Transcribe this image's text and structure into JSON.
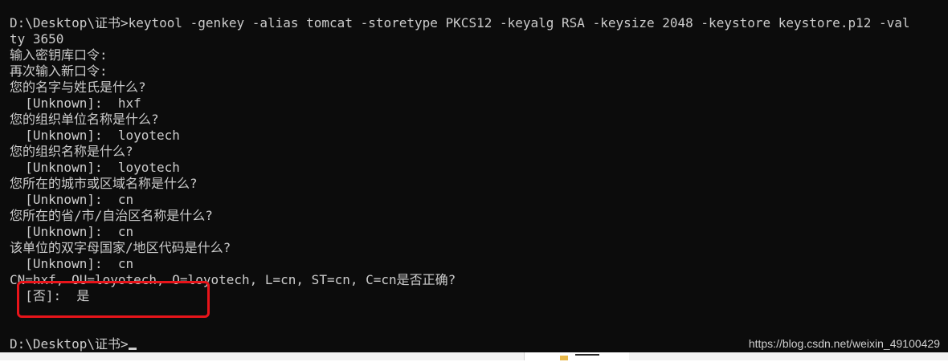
{
  "terminal": {
    "lines": [
      "D:\\Desktop\\证书>keytool -genkey -alias tomcat -storetype PKCS12 -keyalg RSA -keysize 2048 -keystore keystore.p12 -val",
      "ty 3650",
      "输入密钥库口令:",
      "再次输入新口令:",
      "您的名字与姓氏是什么?",
      "  [Unknown]:  hxf",
      "您的组织单位名称是什么?",
      "  [Unknown]:  loyotech",
      "您的组织名称是什么?",
      "  [Unknown]:  loyotech",
      "您所在的城市或区域名称是什么?",
      "  [Unknown]:  cn",
      "您所在的省/市/自治区名称是什么?",
      "  [Unknown]:  cn",
      "该单位的双字母国家/地区代码是什么?",
      "  [Unknown]:  cn",
      "CN=hxf, OU=loyotech, O=loyotech, L=cn, ST=cn, C=cn是否正确?",
      "  [否]:  是",
      ""
    ],
    "prompt": "D:\\Desktop\\证书>"
  },
  "watermark": "https://blog.csdn.net/weixin_49100429",
  "colors": {
    "console_bg": "#0c0c0c",
    "console_text": "#cccccc",
    "highlight": "#e8141a"
  }
}
